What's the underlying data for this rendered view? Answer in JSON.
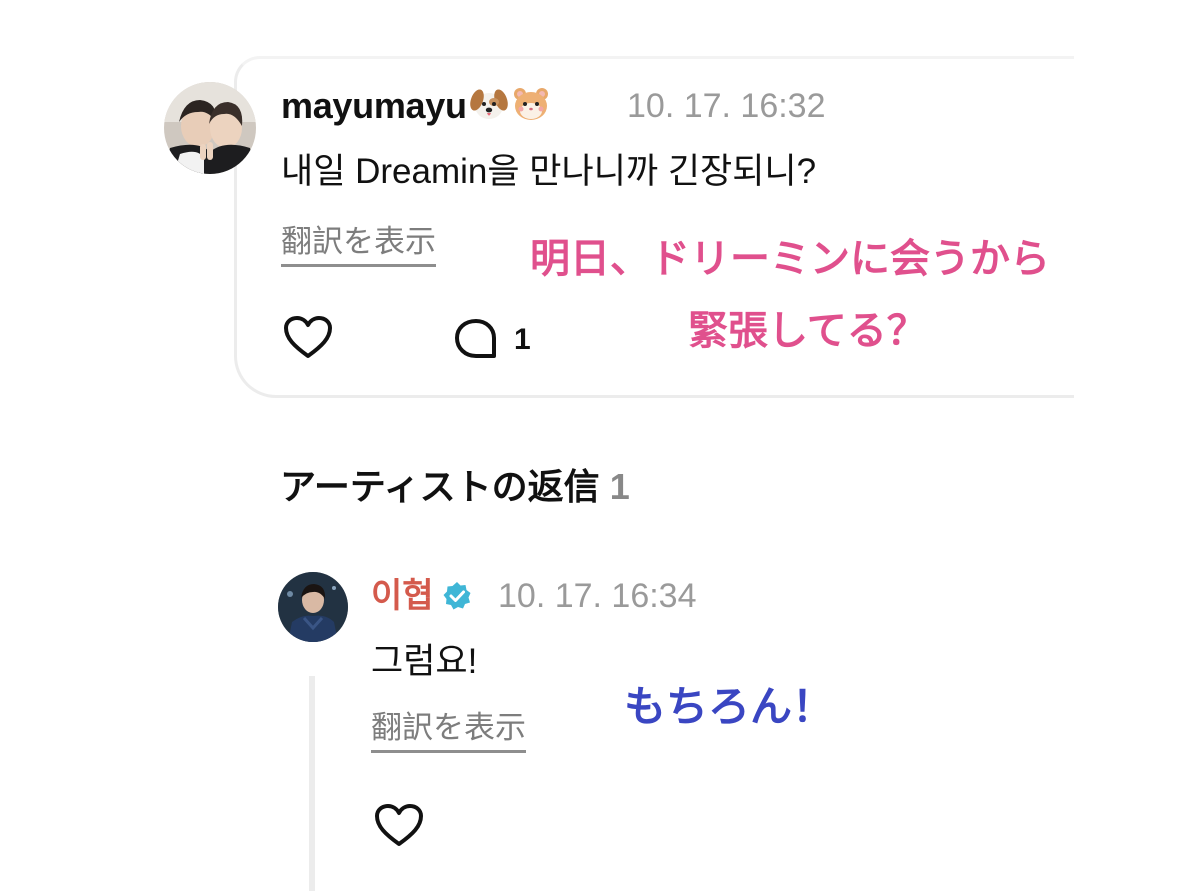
{
  "post": {
    "username": "mayumayu",
    "emojis": [
      "dog-face-emoji",
      "hamster-face-emoji"
    ],
    "timestamp": "10. 17. 16:32",
    "text": "내일 Dreamin을 만나니까 긴장되니?",
    "translate_label": "翻訳を表示",
    "comment_count": "1"
  },
  "overlay_pink": {
    "line1": "明日、ドリーミンに会うから",
    "line2": "緊張してる？"
  },
  "replies_section": {
    "title": "アーティストの返信",
    "count": "1"
  },
  "reply": {
    "artist_name": "이협",
    "timestamp": "10. 17. 16:34",
    "text": "그럼요!",
    "translate_label": "翻訳を表示"
  },
  "overlay_blue": {
    "text": "もちろん！"
  },
  "colors": {
    "pink_overlay": "#e0508d",
    "blue_overlay": "#3a46c2",
    "artist_name": "#d45a4c",
    "verified_badge": "#3fb6d6",
    "muted": "#9a9a9a"
  }
}
